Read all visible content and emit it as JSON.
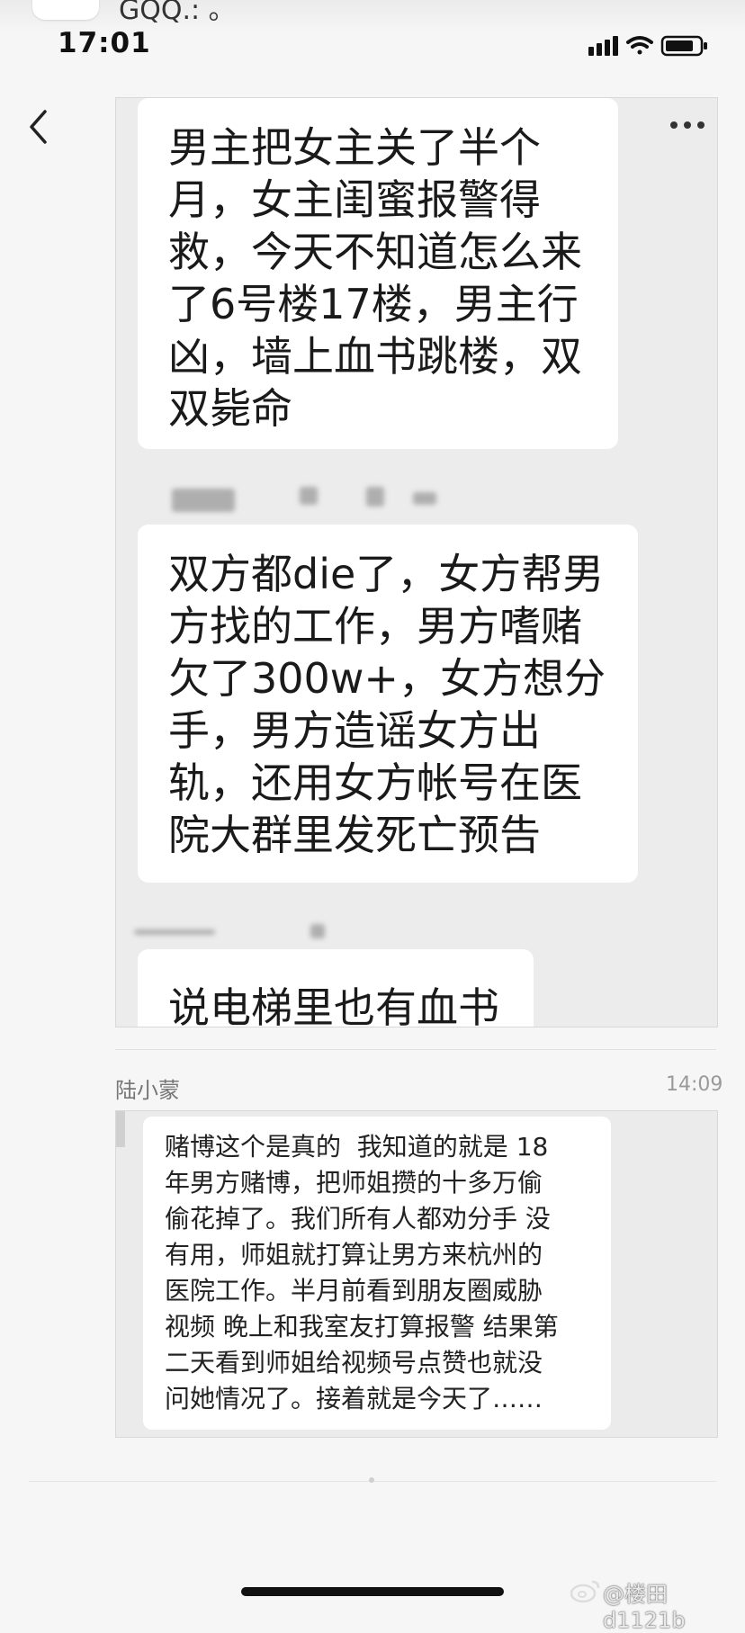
{
  "notification": {
    "text": "GQQ.: 。"
  },
  "status_bar": {
    "time": "17:01"
  },
  "screenshot1": {
    "messages": [
      {
        "text": "男主把女主关了半个\n月，女主闺蜜报警得\n救，今天不知道怎么来\n了6号楼17楼，男主行\n凶，墙上血书跳楼，双\n双毙命"
      },
      {
        "text": "双方都die了，女方帮男\n方找的工作，男方嗜赌\n欠了300w+，女方想分\n手，男方造谣女方出\n轨，还用女方帐号在医\n院大群里发死亡预告"
      },
      {
        "text": "说电梯里也有血书"
      }
    ]
  },
  "chat": {
    "sender": "陆小蒙",
    "time": "14:09"
  },
  "screenshot2": {
    "text": "赌博这个是真的  我知道的就是 18\n年男方赌博，把师姐攒的十多万偷\n偷花掉了。我们所有人都劝分手 没\n有用，师姐就打算让男方来杭州的\n医院工作。半月前看到朋友圈威胁\n视频 晚上和我室友打算报警 结果第\n二天看到师姐给视频号点赞也就没\n问她情况了。接着就是今天了……"
  },
  "watermark": {
    "text": "@楼田d1121b"
  },
  "icons": [
    "qq-penguin-icon",
    "signal-icon",
    "wifi-icon",
    "battery-icon",
    "back-chevron-icon",
    "more-dots-icon",
    "weibo-icon"
  ]
}
